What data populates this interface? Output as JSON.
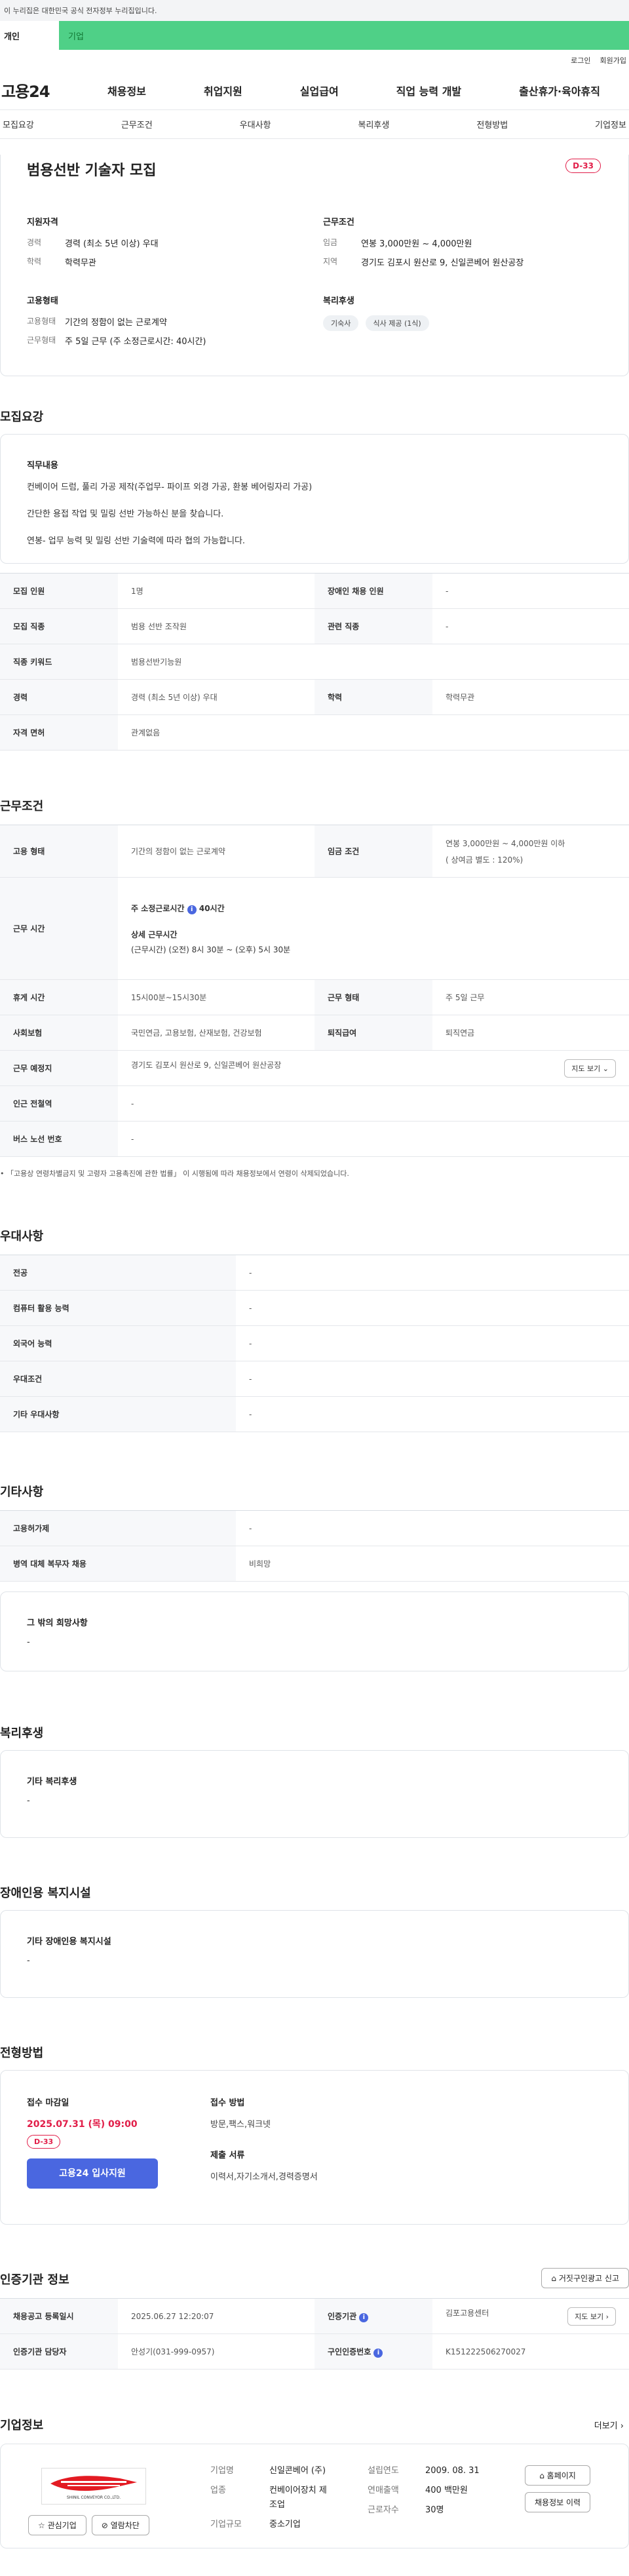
{
  "gov_banner": "이 누리집은 대한민국 공식 전자정부 누리집입니다.",
  "tabs": {
    "user": "개인",
    "biz": "기업"
  },
  "util": {
    "login": "로그인",
    "join": "회원가입"
  },
  "gnb": {
    "logo": "고용24",
    "menu": [
      "채용정보",
      "취업지원",
      "실업급여",
      "직업 능력 개발",
      "출산휴가·육아휴직"
    ]
  },
  "subnav": [
    "모집요강",
    "근무조건",
    "우대사항",
    "복리후생",
    "전형방법",
    "기업정보"
  ],
  "summary": {
    "title": "범용선반 기술자 모집",
    "dday": "D-33",
    "qual_title": "지원자격",
    "career_k": "경력",
    "career_v": "경력 (최소 5년 이상) 우대",
    "edu_k": "학력",
    "edu_v": "학력무관",
    "cond_title": "근무조건",
    "wage_k": "임금",
    "wage_v": "연봉 3,000만원 ~ 4,000만원",
    "region_k": "지역",
    "region_v": "경기도 김포시 원산로 9, 신일콘베어 원산공장",
    "emp_title": "고용형태",
    "emp_k": "고용형태",
    "emp_v": "기간의 정함이 없는 근로계약",
    "work_k": "근무형태",
    "work_v": "주 5일 근무 (주 소정근로시간: 40시간)",
    "welfare_title": "복리후생",
    "chips": [
      "기숙사",
      "식사 제공 (1식)"
    ]
  },
  "recruit": {
    "title": "모집요강",
    "duty_title": "직무내용",
    "duty_lines": [
      "컨베이어 드럼, 풀리 가공 제작(주업무- 파이프 외경 가공, 환봉 베어링자리 가공)",
      "간단한 용접 작업 및 밀링 선반 가능하신 분을 찾습니다.",
      "연봉- 업무 능력 및 밀링 선반 기술력에 따라 협의 가능합니다."
    ],
    "rows": [
      [
        "모집 인원",
        "1명",
        "장애인 채용 인원",
        "-"
      ],
      [
        "모집 직종",
        "범용 선반 조작원",
        "관련 직종",
        "-"
      ],
      [
        "직종 키워드",
        "범용선반기능원",
        "",
        ""
      ],
      [
        "경력",
        "경력 (최소 5년 이상) 우대",
        "학력",
        "학력무관"
      ],
      [
        "자격 면허",
        "관계없음",
        "",
        ""
      ]
    ]
  },
  "work": {
    "title": "근무조건",
    "emp_h": "고용 형태",
    "emp_v": "기간의 정함이 없는 근로계약",
    "wage_h": "임금 조건",
    "wage_v1": "연봉 3,000만원 ~ 4,000만원 이하",
    "wage_v2": "( 상여금 별도 : 120%)",
    "time_h": "근무 시간",
    "time_a": "주 소정근로시간",
    "time_a_v": "40시간",
    "time_b": "상세 근무시간",
    "time_b_v": "(근무시간) (오전) 8시 30분 ~ (오후) 5시 30분",
    "rest_h": "휴게 시간",
    "rest_v": "15시00분~15시30분",
    "form_h": "근무 형태",
    "form_v": "주 5일 근무",
    "ins_h": "사회보험",
    "ins_v": "국민연금, 고용보험, 산재보험, 건강보험",
    "ret_h": "퇴직급여",
    "ret_v": "퇴직연금",
    "place_h": "근무 예정지",
    "place_v": "경기도 김포시 원산로 9, 신일콘베어 원산공장",
    "map_btn": "지도 보기",
    "station_h": "인근 전철역",
    "station_v": "-",
    "bus_h": "버스 노선 번호",
    "bus_v": "-",
    "note": "「고용상 연령차별금지 및 고령자 고용촉진에 관한 법률」 이 시행됨에 따라 채용정보에서 연령이 삭제되었습니다."
  },
  "pref": {
    "title": "우대사항",
    "rows": [
      [
        "전공",
        "-"
      ],
      [
        "컴퓨터 활용 능력",
        "-"
      ],
      [
        "외국어 능력",
        "-"
      ],
      [
        "우대조건",
        "-"
      ],
      [
        "기타 우대사항",
        "-"
      ]
    ]
  },
  "etc": {
    "title": "기타사항",
    "rows": [
      [
        "고용허가제",
        "-"
      ],
      [
        "병역 대체 복무자 채용",
        "비희망"
      ]
    ],
    "box_title": "그 밖의 희망사항",
    "box_v": "-"
  },
  "welfare": {
    "title": "복리후생",
    "box_title": "기타 복리후생",
    "box_v": "-"
  },
  "disab": {
    "title": "장애인용 복지시설",
    "box_title": "기타 장애인용 복지시설",
    "box_v": "-"
  },
  "process": {
    "title": "전형방법",
    "deadline_title": "접수 마감일",
    "deadline": "2025.07.31 (목) 09:00",
    "dday": "D-33",
    "apply_btn": "고용24 입사지원",
    "method_title": "접수 방법",
    "method_v": "방문,팩스,워크넷",
    "docs_title": "제출 서류",
    "docs_v": "이력서,자기소개서,경력증명서"
  },
  "agency": {
    "title": "인증기관 정보",
    "report_btn": "거짓구인광고 신고",
    "reg_h": "채용공고 등록일시",
    "reg_v": "2025.06.27 12:20:07",
    "org_h": "인증기관",
    "org_v": "김포고용센터",
    "map_btn": "지도 보기",
    "mgr_h": "인증기관 담당자",
    "mgr_v": "안성기(031-999-0957)",
    "num_h": "구인인증번호",
    "num_v": "K151222506270027"
  },
  "company": {
    "title": "기업정보",
    "more": "더보기",
    "name_k": "기업명",
    "name_v": "신일콘베어 (주)",
    "ind_k": "업종",
    "ind_v1": "컨베이어장치 제",
    "ind_v2": "조업",
    "size_k": "기업규모",
    "size_v": "중소기업",
    "est_k": "설립연도",
    "est_v": "2009. 08. 31",
    "sales_k": "연매출액",
    "sales_v": "400 백만원",
    "emp_k": "근로자수",
    "emp_v": "30명",
    "home_btn": "홈페이지",
    "jobs_btn": "채용정보 이력",
    "fav_btn": "관심기업",
    "block_btn": "열람차단",
    "logo_text": "SHINIL CONVEYOR CO.,LTD."
  }
}
